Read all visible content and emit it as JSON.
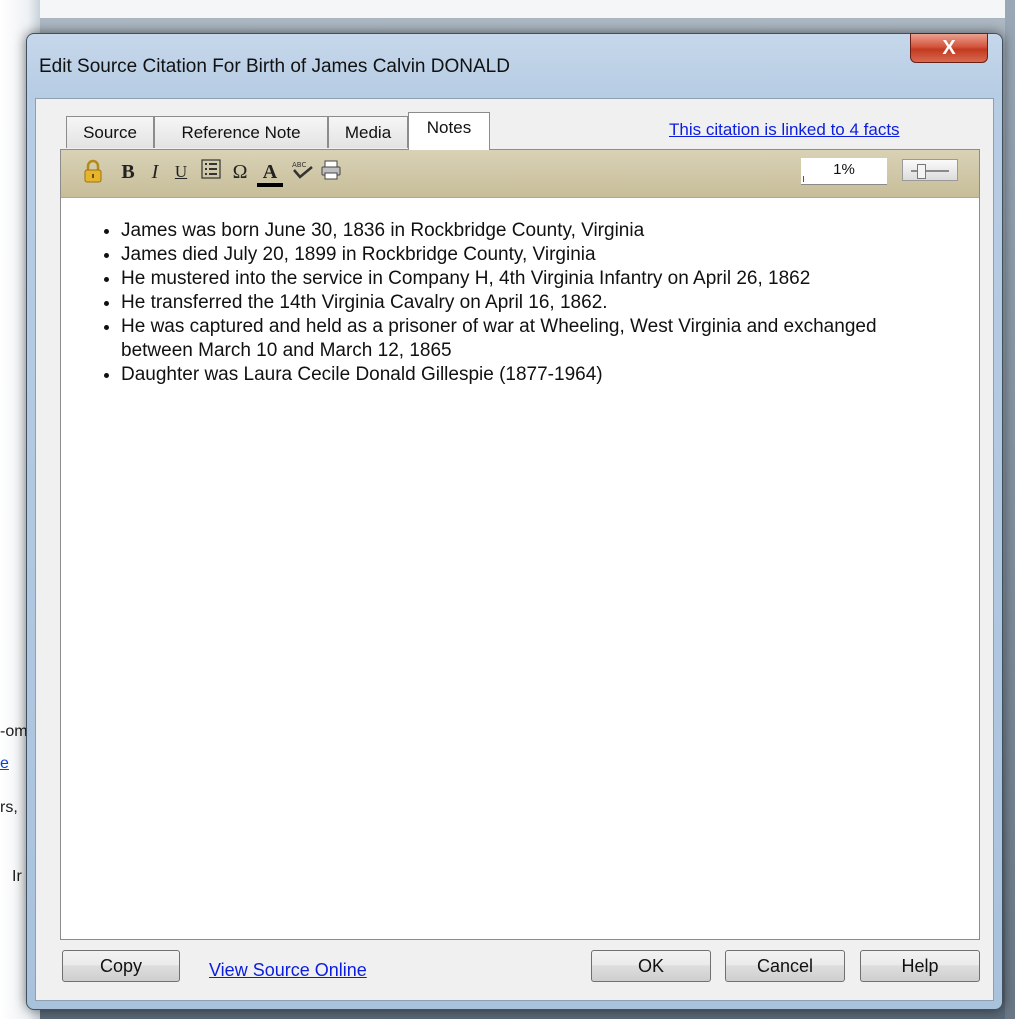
{
  "background": {
    "fragments": [
      "-om",
      "e",
      "rs,",
      "Ir"
    ]
  },
  "dialog": {
    "title": "Edit Source Citation For Birth of James Calvin DONALD",
    "close_label": "X",
    "tabs": [
      {
        "label": "Source",
        "active": false
      },
      {
        "label": "Reference Note",
        "active": false
      },
      {
        "label": "Media",
        "active": false
      },
      {
        "label": "Notes",
        "active": true
      }
    ],
    "linked_facts_link": "This citation is linked to 4 facts",
    "toolbar": {
      "icons": [
        "lock-icon",
        "bold-icon",
        "italic-icon",
        "underline-icon",
        "bullet-list-icon",
        "special-character-icon",
        "font-color-icon",
        "spell-check-icon",
        "print-icon"
      ],
      "bold_glyph": "B",
      "italic_glyph": "I",
      "underline_glyph": "U",
      "omega_glyph": "Ω",
      "font_color_glyph": "A",
      "zoom_value": "1%",
      "zoom_level": 1
    },
    "notes": [
      "James was born June 30, 1836 in Rockbridge County, Virginia",
      "James died July 20, 1899 in Rockbridge County, Virginia",
      "He mustered into the service in Company H, 4th Virginia Infantry on April 26, 1862",
      "He transferred the 14th Virginia Cavalry on April 16, 1862.",
      "He was captured and held as a prisoner of war at Wheeling, West Virginia and exchanged between March 10 and March 12, 1865",
      "Daughter was Laura Cecile Donald Gillespie (1877-1964)"
    ],
    "buttons": {
      "copy": "Copy",
      "view_source_online": "View Source Online",
      "ok": "OK",
      "cancel": "Cancel",
      "help": "Help"
    }
  },
  "colors": {
    "link": "#0b1de0",
    "toolbar": "#cfc6a6",
    "close_button": "#c94a31"
  }
}
